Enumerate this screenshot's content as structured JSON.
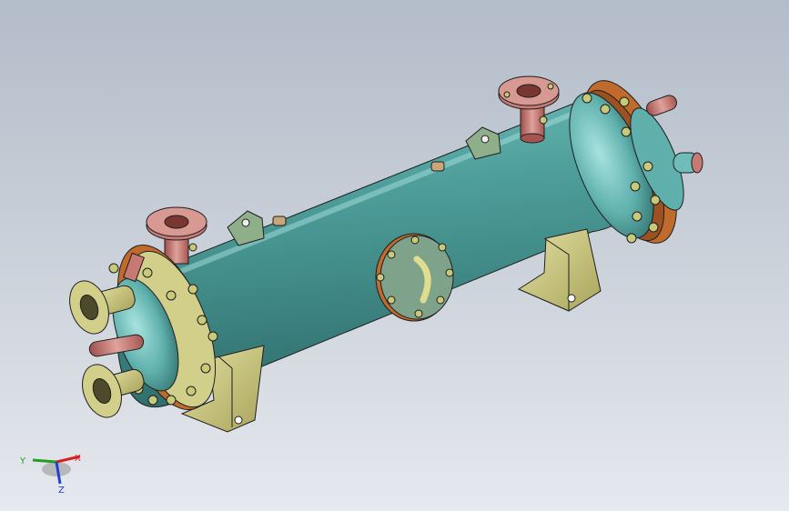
{
  "window": {
    "title": ""
  },
  "model": {
    "name": "",
    "colors": {
      "shell": "#4b9a98",
      "shell_highlight": "#8fd3cf",
      "shell_shadow": "#2f6e6c",
      "flange_orange": "#b7632b",
      "nozzle_red": "#c77a74",
      "bolt_yellow": "#c9c97a",
      "support_yellow": "#d2cf8a",
      "edge": "#1e1e1e"
    }
  },
  "triad": {
    "x_label": "X",
    "y_label": "Y",
    "z_label": "Z",
    "x_color": "#d62020",
    "y_color": "#20a020",
    "z_color": "#2040d0"
  }
}
